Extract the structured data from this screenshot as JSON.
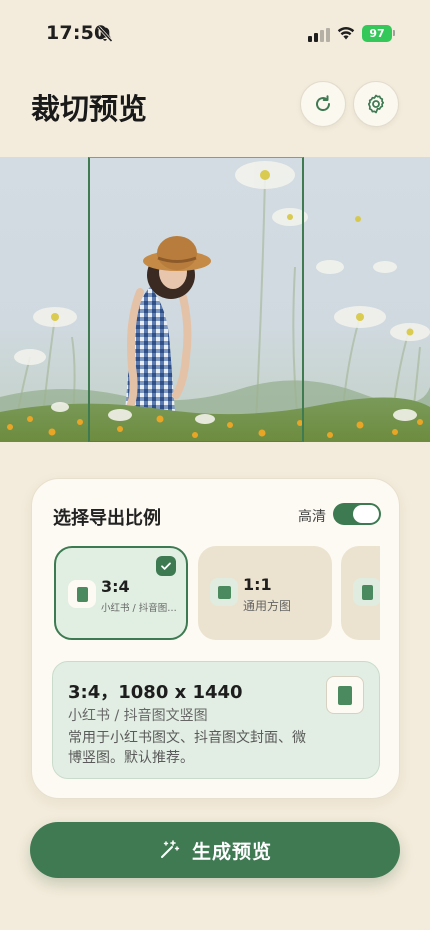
{
  "status_bar": {
    "time": "17:50",
    "battery": "97"
  },
  "header": {
    "title": "裁切预览",
    "refresh_icon": "refresh-icon",
    "settings_icon": "gear-icon"
  },
  "card": {
    "title": "选择导出比例",
    "hd_label": "高清",
    "hd_enabled": true,
    "ratios": [
      {
        "name": "3:4",
        "desc": "小红书 / 抖音图文竖图",
        "selected": true
      },
      {
        "name": "1:1",
        "desc": "通用方图",
        "selected": false
      },
      {
        "name": "",
        "desc": "",
        "selected": false
      }
    ],
    "detail": {
      "title": "3:4，1080 x 1440",
      "subtitle": "小红书 / 抖音图文竖图",
      "description": "常用于小红书图文、抖音图文封面、微博竖图。默认推荐。"
    }
  },
  "generate_button": {
    "label": "生成预览",
    "icon": "magic-wand-icon"
  },
  "colors": {
    "background": "#f3ebdb",
    "accent": "#3f7a53",
    "selected_bg": "#e0efe2",
    "battery": "#34c759"
  }
}
